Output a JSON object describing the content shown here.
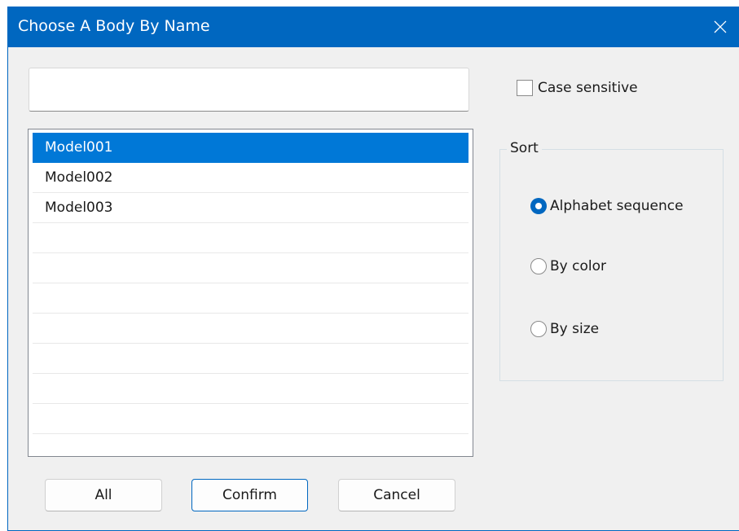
{
  "window": {
    "title": "Choose A Body By Name"
  },
  "search": {
    "value": "",
    "placeholder": ""
  },
  "list": {
    "items": [
      {
        "label": "Model001",
        "selected": true
      },
      {
        "label": "Model002",
        "selected": false
      },
      {
        "label": "Model003",
        "selected": false
      }
    ],
    "empty_rows": 7
  },
  "case_sensitive": {
    "label": "Case sensitive",
    "checked": false
  },
  "sort": {
    "title": "Sort",
    "options": [
      {
        "label": "Alphabet sequence",
        "checked": true
      },
      {
        "label": "By color",
        "checked": false
      },
      {
        "label": "By size",
        "checked": false
      }
    ]
  },
  "buttons": {
    "all": "All",
    "confirm": "Confirm",
    "cancel": "Cancel"
  },
  "colors": {
    "accent": "#0067c0",
    "selection": "#0078d7",
    "background": "#f0f0f0"
  }
}
